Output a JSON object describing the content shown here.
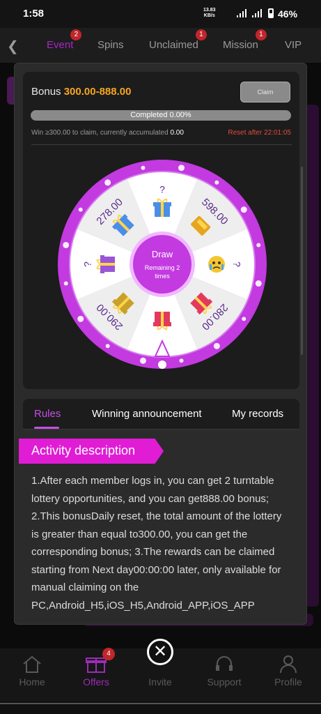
{
  "status_bar": {
    "time": "1:58",
    "net_speed": "13.83",
    "net_unit": "KB/s",
    "battery": "46%"
  },
  "top_nav": {
    "tabs": [
      {
        "label": "Event",
        "badge": "2",
        "active": true
      },
      {
        "label": "Spins",
        "badge": "",
        "active": false
      },
      {
        "label": "Unclaimed",
        "badge": "1",
        "active": false
      },
      {
        "label": "Mission",
        "badge": "1",
        "active": false
      },
      {
        "label": "VIP",
        "badge": "",
        "active": false
      }
    ]
  },
  "bonus": {
    "label": "Bonus",
    "amount": "300.00-888.00",
    "claim_label": "Claim",
    "progress_text": "Completed 0.00%",
    "progress_fraction": 0,
    "accum_text": "Win ≥300.00 to claim, currently accumulated",
    "accum_value": "0.00",
    "reset_text": "Reset after 22:01:05"
  },
  "wheel": {
    "center_label": "Draw",
    "remaining_text": "Remaining  2",
    "times_text": "times",
    "segments": [
      {
        "label": "?",
        "icon": "gift-blue-icon"
      },
      {
        "label": "598.00",
        "icon": "gold-bars-icon"
      },
      {
        "label": "?",
        "icon": "crying-emoji-icon"
      },
      {
        "label": "280.00",
        "icon": "gift-red-icon"
      },
      {
        "label": "",
        "icon": "gift-red-icon"
      },
      {
        "label": "290.00",
        "icon": "gift-gold-icon"
      },
      {
        "label": "?",
        "icon": "gift-purple-icon"
      },
      {
        "label": "278.00",
        "icon": "gift-blue-icon"
      }
    ]
  },
  "tabs": {
    "rules": "Rules",
    "winning": "Winning announcement",
    "records": "My records"
  },
  "activity": {
    "title": "Activity description",
    "text": "1.After each member logs in, you can get 2 turntable lottery opportunities, and you can get888.00 bonus; 2.This bonusDaily reset, the total amount of the lottery is greater than equal to300.00, you can get the corresponding bonus; 3.The rewards can be claimed starting from Next day00:00:00 later, only available for manual claiming on the PC,Android_H5,iOS_H5,Android_APP,iOS_APP"
  },
  "bottom_nav": {
    "items": [
      {
        "label": "Home",
        "icon": "home-icon"
      },
      {
        "label": "Offers",
        "icon": "gift-icon",
        "badge": "4"
      },
      {
        "label": "Invite",
        "icon": "close-icon"
      },
      {
        "label": "Support",
        "icon": "headset-icon"
      },
      {
        "label": "Profile",
        "icon": "user-icon"
      }
    ]
  },
  "colors": {
    "accent": "#c64ee6",
    "wheel_rim": "#c23ae0",
    "bonus_amount": "#f5a623",
    "reset": "#e04a3c",
    "badge": "#c0262b"
  }
}
